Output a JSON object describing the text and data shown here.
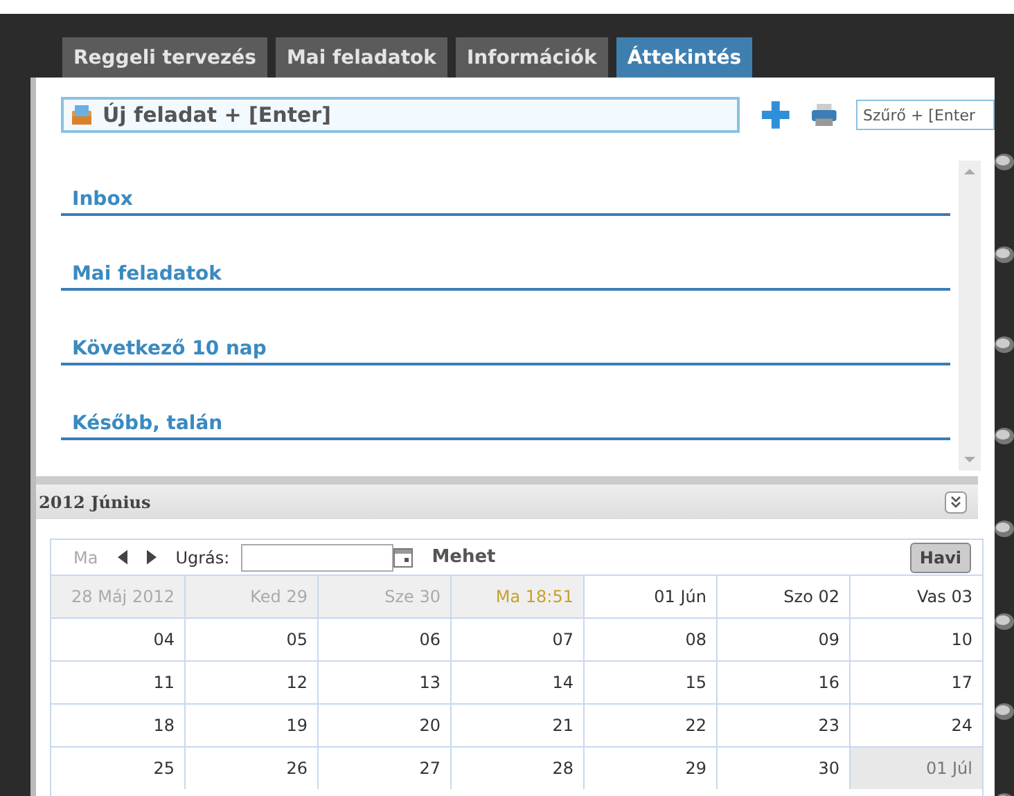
{
  "tabs": [
    {
      "label": "Reggeli tervezés",
      "selected": false
    },
    {
      "label": "Mai feladatok",
      "selected": false
    },
    {
      "label": "Információk",
      "selected": false
    },
    {
      "label": "Áttekintés",
      "selected": true
    }
  ],
  "new_task": {
    "placeholder": "Új feladat + [Enter]"
  },
  "filter": {
    "placeholder": "Szűrő + [Enter"
  },
  "sections": [
    "Inbox",
    "Mai feladatok",
    "Következő 10 nap",
    "Később, talán"
  ],
  "calendar": {
    "title": "2012 Június",
    "today_button": {
      "label": "Ma",
      "disabled": true
    },
    "jump_label": "Ugrás:",
    "go_button": "Mehet",
    "view_button": {
      "label": "Havi",
      "selected": true
    },
    "weeks": [
      [
        {
          "text": "28 Máj 2012",
          "kind": "past"
        },
        {
          "text": "Ked 29",
          "kind": "past"
        },
        {
          "text": "Sze 30",
          "kind": "past"
        },
        {
          "text": "Ma 18:51",
          "kind": "today"
        },
        {
          "text": "01 Jún",
          "kind": "day"
        },
        {
          "text": "Szo 02",
          "kind": "day"
        },
        {
          "text": "Vas 03",
          "kind": "day"
        }
      ],
      [
        {
          "text": "04",
          "kind": "day"
        },
        {
          "text": "05",
          "kind": "day"
        },
        {
          "text": "06",
          "kind": "day"
        },
        {
          "text": "07",
          "kind": "day"
        },
        {
          "text": "08",
          "kind": "day"
        },
        {
          "text": "09",
          "kind": "day"
        },
        {
          "text": "10",
          "kind": "day"
        }
      ],
      [
        {
          "text": "11",
          "kind": "day"
        },
        {
          "text": "12",
          "kind": "day"
        },
        {
          "text": "13",
          "kind": "day"
        },
        {
          "text": "14",
          "kind": "day"
        },
        {
          "text": "15",
          "kind": "day"
        },
        {
          "text": "16",
          "kind": "day"
        },
        {
          "text": "17",
          "kind": "day"
        }
      ],
      [
        {
          "text": "18",
          "kind": "day"
        },
        {
          "text": "19",
          "kind": "day"
        },
        {
          "text": "20",
          "kind": "day"
        },
        {
          "text": "21",
          "kind": "day"
        },
        {
          "text": "22",
          "kind": "day"
        },
        {
          "text": "23",
          "kind": "day"
        },
        {
          "text": "24",
          "kind": "day"
        }
      ],
      [
        {
          "text": "25",
          "kind": "day"
        },
        {
          "text": "26",
          "kind": "day"
        },
        {
          "text": "27",
          "kind": "day"
        },
        {
          "text": "28",
          "kind": "day"
        },
        {
          "text": "29",
          "kind": "day"
        },
        {
          "text": "30",
          "kind": "day"
        },
        {
          "text": "01 Júl",
          "kind": "next_month"
        }
      ]
    ]
  }
}
